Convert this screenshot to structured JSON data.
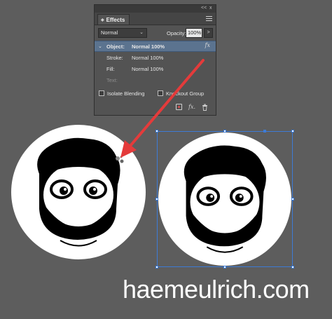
{
  "panel": {
    "topbar_collapse": "<<",
    "topbar_close": "x",
    "tab_label": "Effects",
    "blend_mode": "Normal",
    "opacity_label": "Opacity:",
    "opacity_value": "100%",
    "opacity_button": ">",
    "rows": [
      {
        "name": "Object:",
        "setting": "Normal 100%",
        "selected": true
      },
      {
        "name": "Stroke:",
        "setting": "Normal 100%"
      },
      {
        "name": "Fill:",
        "setting": "Normal 100%"
      },
      {
        "name": "Text:",
        "setting": ""
      }
    ],
    "fx_label": "fx",
    "isolate_blending_label": "Isolate Blending",
    "knockout_group_label": "Knockout Group",
    "bottom_fx_label": "fx."
  },
  "brand_text": "haemeulrich.com",
  "colors": {
    "background": "#5d5d5d",
    "panel": "#535353",
    "selected_row": "#5b738f",
    "selection": "#3d7bd6",
    "arrow": "#e43b3b"
  },
  "icons": [
    "chevron-down-icon",
    "panel-menu-icon",
    "fx-icon",
    "clear-effects-icon",
    "trash-icon",
    "fx-badge-icon"
  ]
}
